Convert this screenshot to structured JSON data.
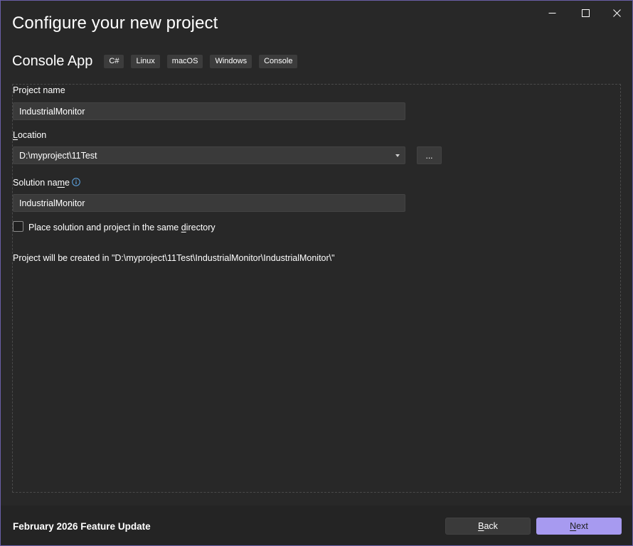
{
  "dialog": {
    "title": "Configure your new project",
    "template_name": "Console App",
    "tags": [
      "C#",
      "Linux",
      "macOS",
      "Windows",
      "Console"
    ]
  },
  "form": {
    "project_name_label": "Project name",
    "project_name_value": "IndustrialMonitor",
    "location_label_prefix": "",
    "location_label_accel": "L",
    "location_label_rest": "ocation",
    "location_value": "D:\\myproject\\11Test",
    "browse_label": "...",
    "solution_name_label_prefix": "Solution na",
    "solution_name_label_accel": "m",
    "solution_name_label_rest": "e",
    "solution_name_value": "IndustrialMonitor",
    "same_dir_label_prefix": "Place solution and project in the same ",
    "same_dir_label_accel": "d",
    "same_dir_label_rest": "irectory",
    "same_dir_checked": false,
    "created_path_text": "Project will be created in \"D:\\myproject\\11Test\\IndustrialMonitor\\IndustrialMonitor\\\""
  },
  "footer": {
    "update_text": "February 2026 Feature Update",
    "back_accel": "B",
    "back_rest": "ack",
    "next_accel": "N",
    "next_rest": "ext"
  },
  "colors": {
    "accent": "#a79af0",
    "window_border": "#6a5fa8",
    "background": "#282828"
  },
  "icons": {
    "minimize": "minimize-icon",
    "maximize": "maximize-icon",
    "close": "close-icon",
    "info": "info-icon",
    "dropdown": "chevron-down-icon"
  }
}
